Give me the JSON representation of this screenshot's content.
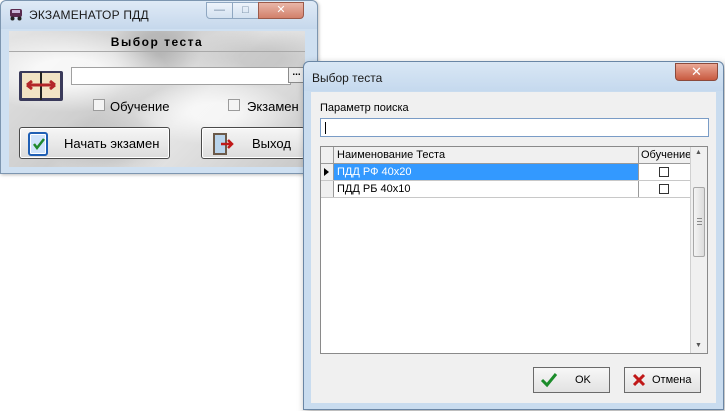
{
  "main_window": {
    "title": "ЭКЗАМЕНАТОР ПДД",
    "minimize": "—",
    "maximize": "□",
    "close": "✕",
    "section_title": "Выбор теста",
    "browse": "...",
    "training_label": "Обучение",
    "exam_label": "Экзамен",
    "start_button": "Начать экзамен",
    "exit_button": "Выход"
  },
  "dialog": {
    "title": "Выбор теста",
    "close": "✕",
    "search_label": "Параметр поиска",
    "search_value": "",
    "columns": [
      "Наименование Теста",
      "Обучение"
    ],
    "rows": [
      {
        "name": "ПДД РФ 40х20",
        "training": false,
        "selected": true
      },
      {
        "name": "ПДД РБ 40х10",
        "training": false,
        "selected": false
      }
    ],
    "ok_button": "OK",
    "cancel_button": "Отмена"
  },
  "icons": [
    "car-icon",
    "book-icon",
    "checklist-icon",
    "door-exit-icon",
    "checkmark-icon",
    "cross-icon"
  ],
  "colors": {
    "selection": "#3399ff",
    "titlebar": "#cfe0f1",
    "close": "#c85a40"
  }
}
